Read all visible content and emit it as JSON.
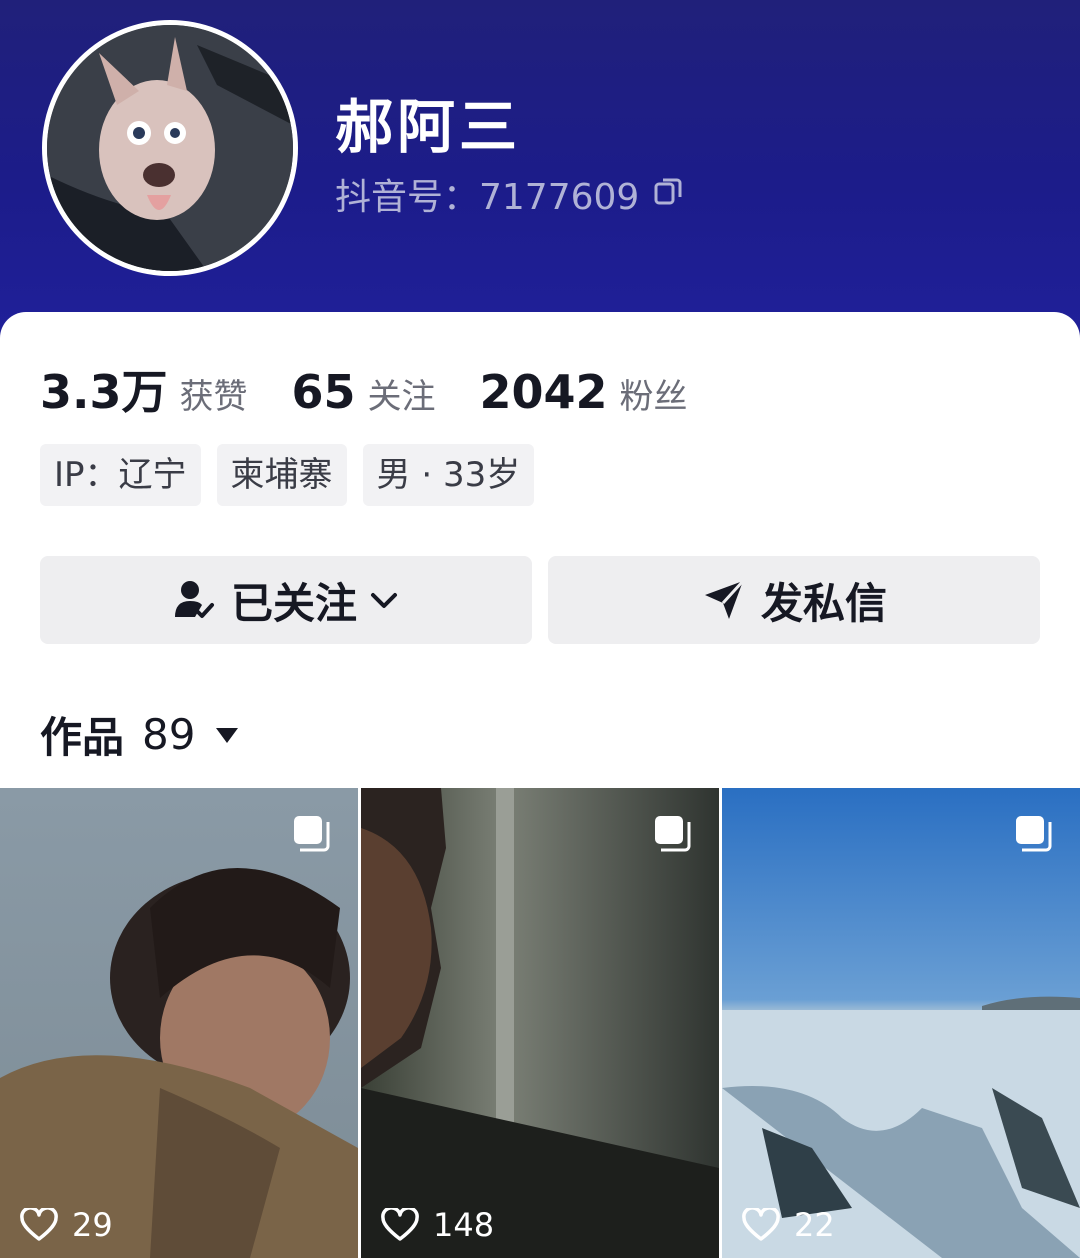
{
  "profile": {
    "name": "郝阿三",
    "douyin_id": "抖音号：7177609"
  },
  "stats": [
    {
      "value": "3.3万",
      "label": "获赞"
    },
    {
      "value": "65",
      "label": "关注"
    },
    {
      "value": "2042",
      "label": "粉丝"
    }
  ],
  "tags": [
    "IP：辽宁",
    "柬埔寨",
    "男 · 33岁"
  ],
  "actions": {
    "follow_label": "已关注",
    "message_label": "发私信"
  },
  "works": {
    "label": "作品",
    "count": "89"
  },
  "videos": [
    {
      "likes": "29",
      "icon": "multi-image-icon"
    },
    {
      "likes": "148",
      "icon": "multi-image-icon"
    },
    {
      "likes": "22",
      "icon": "multi-image-icon"
    }
  ],
  "colors": {
    "header_bg": "#1c1c8a",
    "primary_text": "#161823",
    "secondary_text": "#6b6d78",
    "button_bg": "#eeeef0"
  }
}
